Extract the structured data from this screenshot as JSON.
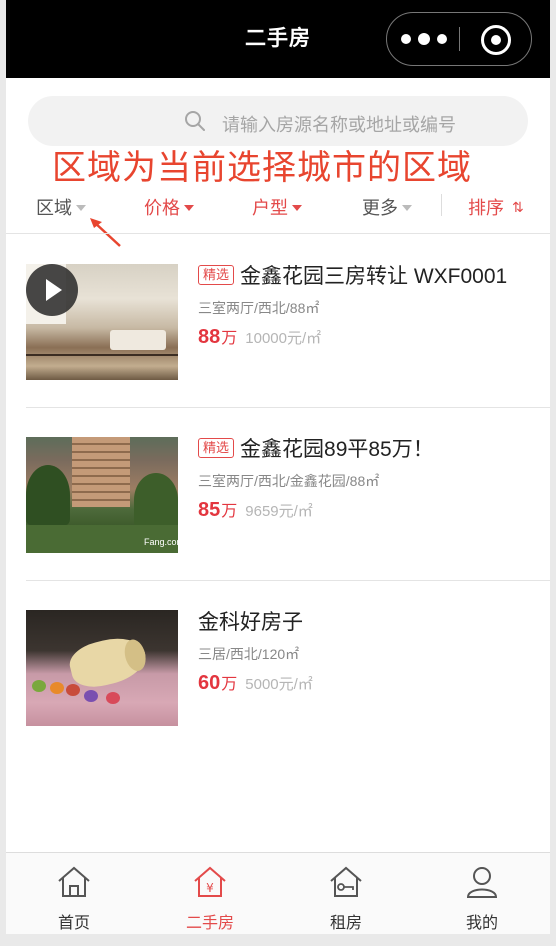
{
  "titlebar": {
    "title": "二手房"
  },
  "search": {
    "placeholder": "请输入房源名称或地址或编号"
  },
  "annotation": {
    "text": "区域为当前选择城市的区域"
  },
  "filters": {
    "area": "区域",
    "price": "价格",
    "layout": "户型",
    "more": "更多",
    "sort": "排序",
    "sort_icon": "⇅"
  },
  "listings": [
    {
      "tag": "精选",
      "name": "金鑫花园三房转让 WXF0001",
      "desc": "三室两厅/西北/88㎡",
      "price": "88",
      "unit": "万",
      "unit_price": "10000元/㎡",
      "has_video": true
    },
    {
      "tag": "精选",
      "name": "金鑫花园89平85万！",
      "desc": "三室两厅/西北/金鑫花园/88㎡",
      "price": "85",
      "unit": "万",
      "unit_price": "9659元/㎡",
      "watermark": "Fang.com"
    },
    {
      "name": "金科好房子",
      "desc": "三居/西北/120㎡",
      "price": "60",
      "unit": "万",
      "unit_price": "5000元/㎡"
    }
  ],
  "tabbar": {
    "home": "首页",
    "secondhand": "二手房",
    "rent": "租房",
    "mine": "我的",
    "active": "secondhand",
    "accent_color": "#e34a4a"
  },
  "icons": {
    "search": "search-icon",
    "more": "more-dots-icon",
    "close": "close-miniprogram-icon",
    "play": "play-icon",
    "home": "home-icon",
    "secondhand": "house-yen-icon",
    "rent": "house-key-icon",
    "mine": "user-icon"
  }
}
